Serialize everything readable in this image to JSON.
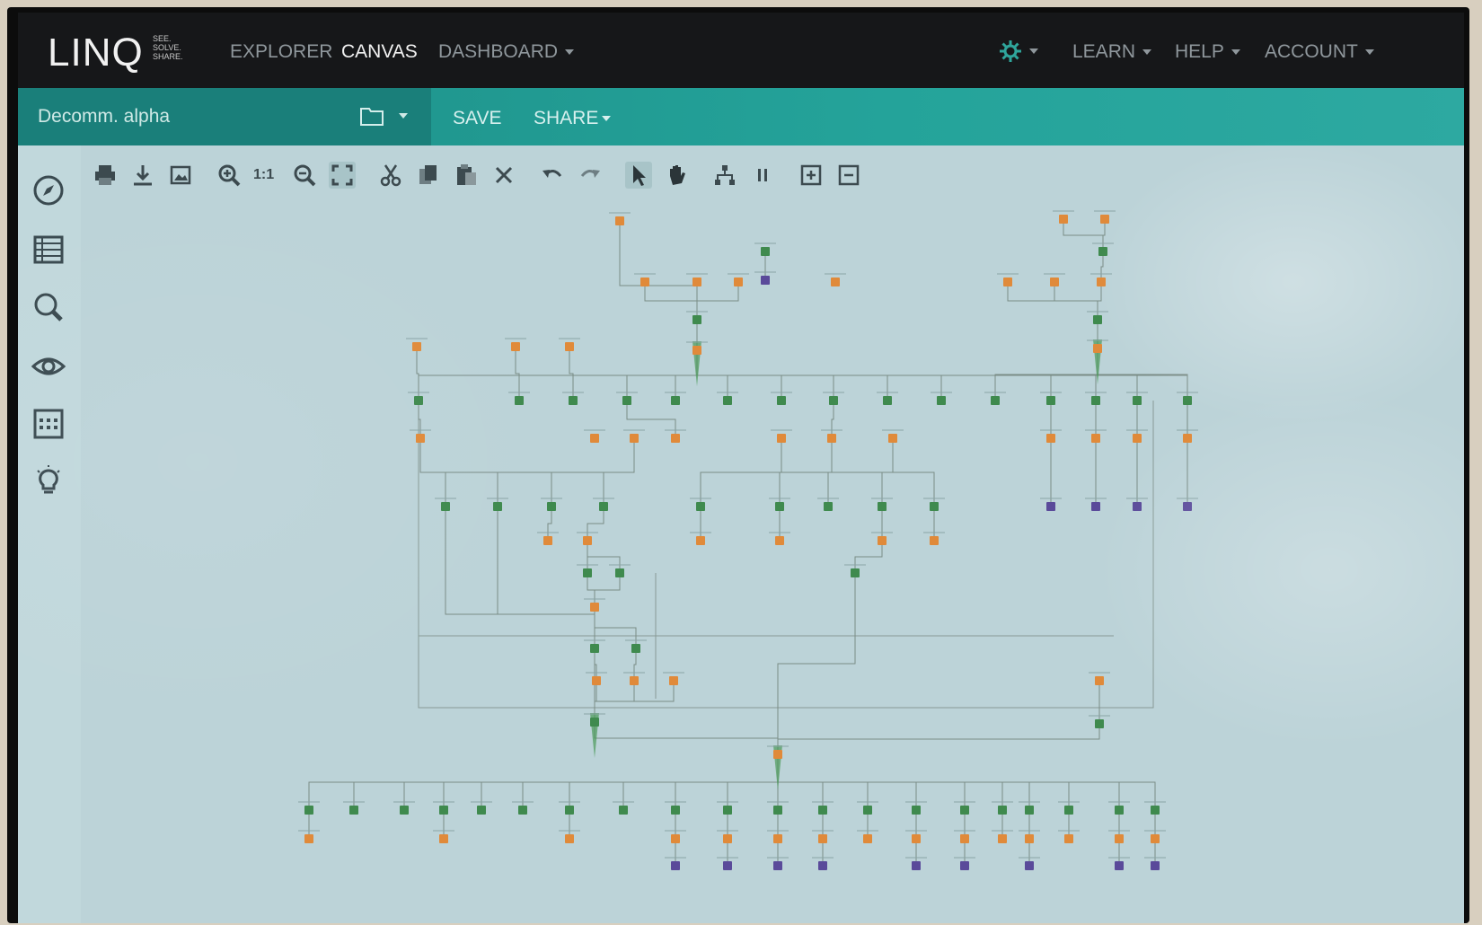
{
  "app": {
    "logo_text": "LINQ",
    "tagline": [
      "SEE.",
      "SOLVE.",
      "SHARE."
    ]
  },
  "nav": {
    "explorer": "EXPLORER",
    "canvas": "CANVAS",
    "dashboard": "DASHBOARD",
    "learn": "LEARN",
    "help": "HELP",
    "account": "ACCOUNT"
  },
  "project": {
    "name": "Decomm. alpha",
    "save": "SAVE",
    "share": "SHARE"
  },
  "toolbar": {
    "actual_size": "1:1"
  },
  "rail_icons": [
    "compass-icon",
    "table-icon",
    "search-icon",
    "eye-icon",
    "grid-icon",
    "lightbulb-icon"
  ],
  "colors": {
    "nav_bg": "#161719",
    "teal": "#24a39a",
    "node_green": "#3f8a4e",
    "node_orange": "#e08a3a",
    "node_purple": "#5a4a9a",
    "edge": "#7a8c86"
  }
}
